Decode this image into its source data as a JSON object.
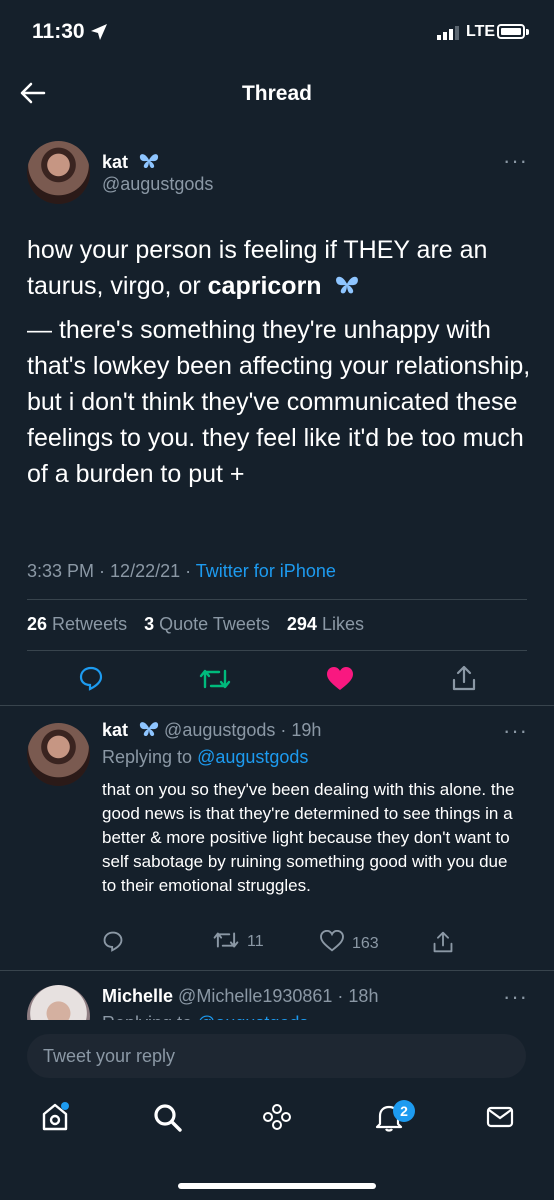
{
  "status_bar": {
    "time": "11:30",
    "network": "LTE"
  },
  "nav": {
    "title": "Thread"
  },
  "main_tweet": {
    "name": "kat",
    "handle": "@augustgods",
    "line1": "how your person is feeling if THEY are an taurus, virgo, or ",
    "line1_bold": "capricorn",
    "line2": "— there's something they're unhappy with that's lowkey been affecting your relationship, but i don't think they've communicated these feelings to you. they feel like it'd be too much of a burden to put +",
    "time": "3:33 PM",
    "date": "12/22/21",
    "source": "Twitter for iPhone",
    "retweets": "26",
    "retweets_label": "Retweets",
    "quotes": "3",
    "quotes_label": "Quote Tweets",
    "likes": "294",
    "likes_label": "Likes",
    "colors": {
      "like": "#f91880",
      "retweet": "#00ba7c",
      "accent": "#1d9bf0"
    }
  },
  "reply": {
    "name": "kat",
    "handle": "@augustgods",
    "age": "19h",
    "replying_prefix": "Replying to ",
    "replying_handle": "@augustgods",
    "text": "that on you so they've been dealing with this alone. the good news is that they're determined to see things in a better & more positive light because they don't want to self sabotage by ruining something good with you due to their emotional struggles.",
    "retweets": "11",
    "likes": "163"
  },
  "third_reply": {
    "name": "Michelle",
    "handle": "@Michelle1930861",
    "age": "18h",
    "replying_prefix": "Replying to ",
    "replying_handle": "@augustgods"
  },
  "reply_box": {
    "placeholder": "Tweet your reply"
  },
  "tab_bar": {
    "items": [
      "home-icon",
      "search-icon",
      "spaces-icon",
      "notifications-icon",
      "messages-icon"
    ],
    "notification_count": "2"
  }
}
